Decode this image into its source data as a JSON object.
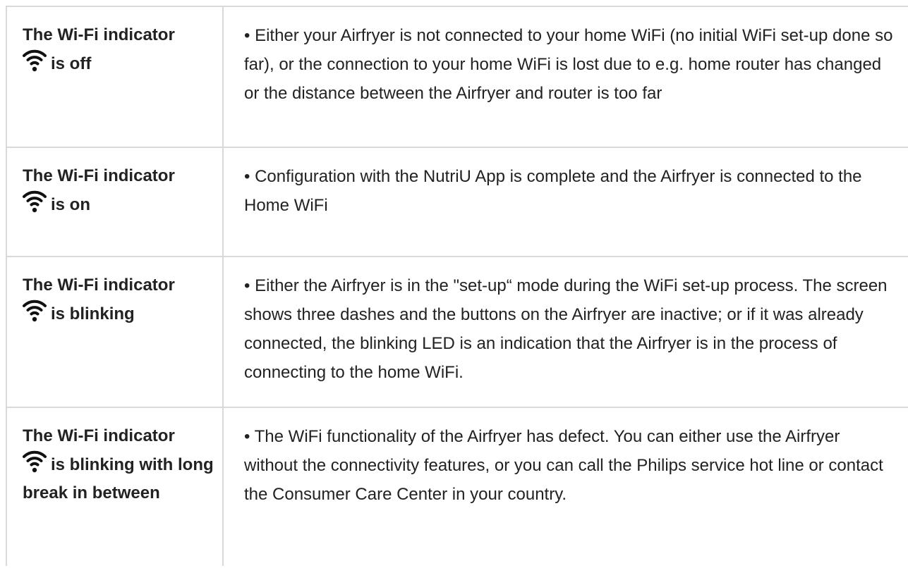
{
  "rows": [
    {
      "indicator_label": "The Wi-Fi indicator",
      "state": "is off",
      "icon": "wifi-icon",
      "description": "• Either your Airfryer is not connected to your home WiFi (no initial WiFi set-up done so far), or the connection to your home WiFi is lost due to e.g. home router has changed or the distance between the Airfryer and router is too far"
    },
    {
      "indicator_label": "The Wi-Fi indicator",
      "state": "is on",
      "icon": "wifi-icon",
      "description": "• Configuration with the NutriU App is complete and the Airfryer is connected to the Home WiFi"
    },
    {
      "indicator_label": "The Wi-Fi indicator",
      "state": "is blinking",
      "icon": "wifi-icon",
      "description": "• Either the Airfryer is in the \"set-up“ mode during the WiFi set-up process. The screen shows three dashes and the buttons on the Airfryer are inactive; or if it was already connected, the blinking LED is an indication that the Airfryer is in the process of connecting to the home WiFi."
    },
    {
      "indicator_label": "The Wi-Fi indicator",
      "state": "is blinking with long break in between",
      "icon": "wifi-icon",
      "description": "• The WiFi functionality of the Airfryer has defect. You can either use the Airfryer without the connectivity features, or you can call the Philips service hot line or contact the Consumer Care Center in your country."
    }
  ],
  "colors": {
    "border": "#d9d9d9",
    "text": "#222222",
    "background": "#ffffff"
  }
}
